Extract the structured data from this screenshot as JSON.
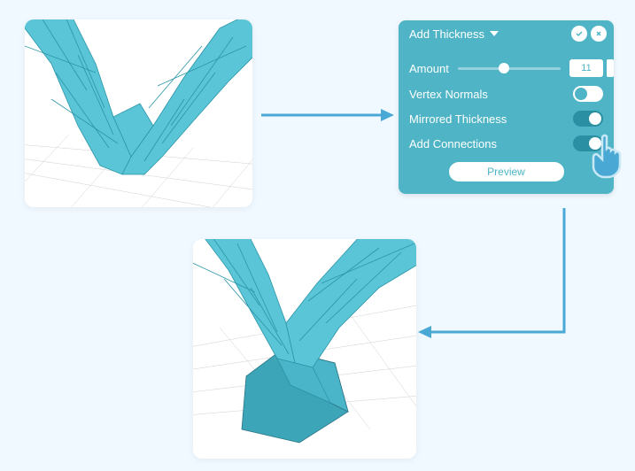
{
  "panel": {
    "title": "Add Thickness",
    "amount": {
      "label": "Amount",
      "value": "11"
    },
    "options": [
      {
        "label": "Vertex Normals",
        "on": false
      },
      {
        "label": "Mirrored Thickness",
        "on": true
      },
      {
        "label": "Add Connections",
        "on": true
      }
    ],
    "preview_label": "Preview"
  },
  "colors": {
    "panel": "#4fb5c6",
    "mesh_fill": "#5ac5d6",
    "mesh_edge": "#2a95a8",
    "arrow": "#4aa8d4"
  }
}
